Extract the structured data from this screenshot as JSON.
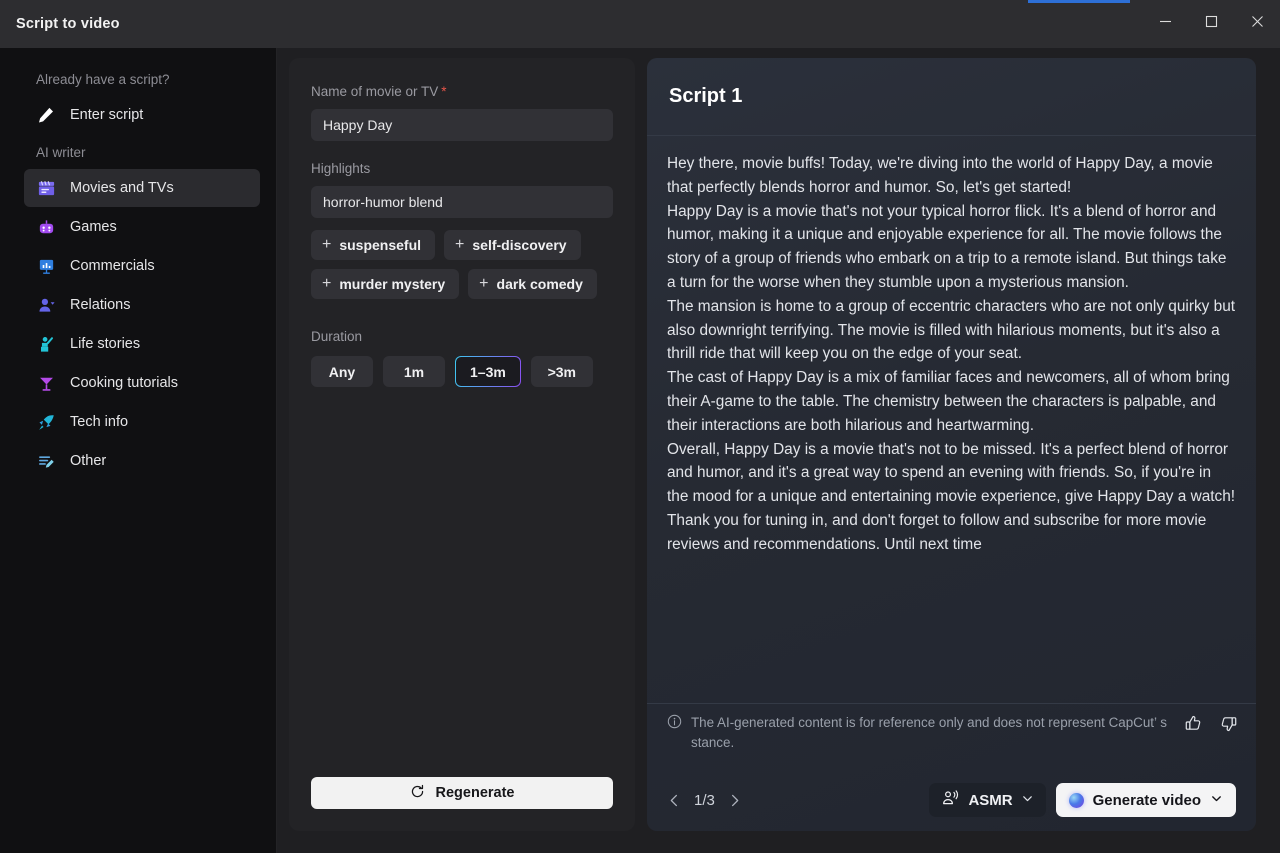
{
  "window": {
    "title": "Script to video",
    "accent_color": "#2d6fd6",
    "controls": [
      {
        "name": "minimize",
        "glyph": "minimize-icon"
      },
      {
        "name": "maximize",
        "glyph": "maximize-icon"
      },
      {
        "name": "close",
        "glyph": "close-icon"
      }
    ]
  },
  "sidebar": {
    "groups": [
      {
        "label": "Already have a script?",
        "items": [
          {
            "label": "Enter script",
            "icon": "pencil-icon",
            "active": false
          }
        ]
      },
      {
        "label": "AI writer",
        "items": [
          {
            "label": "Movies and TVs",
            "icon": "clapperboard-icon",
            "active": true
          },
          {
            "label": "Games",
            "icon": "gamepad-icon",
            "active": false
          },
          {
            "label": "Commercials",
            "icon": "presentation-chart-icon",
            "active": false
          },
          {
            "label": "Relations",
            "icon": "people-icon",
            "active": false
          },
          {
            "label": "Life stories",
            "icon": "person-waving-icon",
            "active": false
          },
          {
            "label": "Cooking tutorials",
            "icon": "cocktail-glass-icon",
            "active": false
          },
          {
            "label": "Tech info",
            "icon": "rocket-icon",
            "active": false
          },
          {
            "label": "Other",
            "icon": "document-edit-icon",
            "active": false
          }
        ]
      }
    ]
  },
  "form": {
    "name_label": "Name of movie or TV",
    "name_required_mark": "*",
    "name_value": "Happy Day",
    "highlights_label": "Highlights",
    "highlights_value": "horror-humor blend",
    "suggested_chips": [
      {
        "label": "suspenseful",
        "prefix": "+"
      },
      {
        "label": "self-discovery",
        "prefix": "+"
      },
      {
        "label": "murder mystery",
        "prefix": "+"
      },
      {
        "label": "dark comedy",
        "prefix": "+"
      }
    ],
    "duration_label": "Duration",
    "duration_options": [
      {
        "label": "Any",
        "selected": false
      },
      {
        "label": "1m",
        "selected": false
      },
      {
        "label": "1–3m",
        "selected": true
      },
      {
        "label": ">3m",
        "selected": false
      }
    ],
    "regenerate_label": "Regenerate",
    "regenerate_icon": "refresh-icon"
  },
  "script": {
    "title": "Script 1",
    "paragraphs": [
      "Hey there, movie buffs! Today, we're diving into the world of Happy Day, a movie that perfectly blends horror and humor. So, let's get started!",
      "Happy Day is a movie that's not your typical horror flick. It's a blend of horror and humor, making it a unique and enjoyable experience for all. The movie follows the story of a group of friends who embark on a trip to a remote island. But things take a turn for the worse when they stumble upon a mysterious mansion.",
      "The mansion is home to a group of eccentric characters who are not only quirky but also downright terrifying. The movie is filled with hilarious moments, but it's also a thrill ride that will keep you on the edge of your seat.",
      "The cast of Happy Day is a mix of familiar faces and newcomers, all of whom bring their A-game to the table. The chemistry between the characters is palpable, and their interactions are both hilarious and heartwarming.",
      "Overall, Happy Day is a movie that's not to be missed. It's a perfect blend of horror and humor, and it's a great way to spend an evening with friends. So, if you're in the mood for a unique and entertaining movie experience, give Happy Day a watch!",
      "Thank you for tuning in, and don't forget to follow and subscribe for more movie reviews and recommendations. Until next time"
    ],
    "disclaimer": "The AI-generated content is for reference only and does not represent CapCut’ s stance.",
    "disclaimer_icon": "info-icon",
    "thumbs_up_icon": "thumbs-up-icon",
    "thumbs_down_icon": "thumbs-down-icon",
    "pager": {
      "prev_icon": "chevron-left-icon",
      "next_icon": "chevron-right-icon",
      "value": "1/3"
    },
    "voice_button": {
      "label": "ASMR",
      "icon": "voice-person-icon",
      "chevron": "chevron-down-icon"
    },
    "generate_button": {
      "label": "Generate video",
      "icon": "ai-orb-icon",
      "chevron": "chevron-down-icon"
    }
  }
}
